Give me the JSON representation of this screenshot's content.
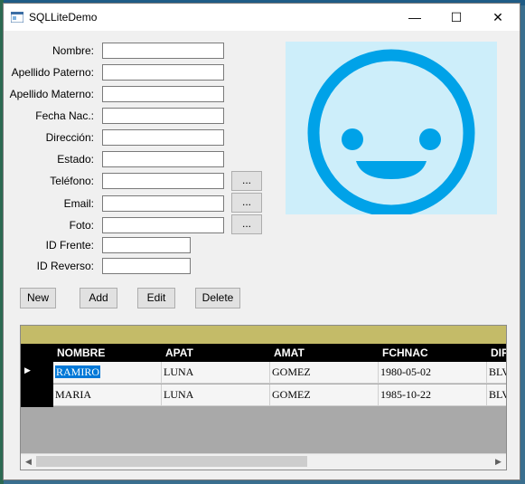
{
  "window": {
    "title": "SQLLiteDemo",
    "minimize": "—",
    "maximize": "☐",
    "close": "✕"
  },
  "form": {
    "labels": {
      "nombre": "Nombre:",
      "apellido_paterno": "Apellido Paterno:",
      "apellido_materno": "Apellido Materno:",
      "fecha_nac": "Fecha Nac.:",
      "direccion": "Dirección:",
      "estado": "Estado:",
      "telefono": "Teléfono:",
      "email": "Email:",
      "foto": "Foto:",
      "id_frente": "ID Frente:",
      "id_reverso": "ID Reverso:"
    },
    "values": {
      "nombre": "",
      "apellido_paterno": "",
      "apellido_materno": "",
      "fecha_nac": "",
      "direccion": "",
      "estado": "",
      "telefono": "",
      "email": "",
      "foto": "",
      "id_frente": "",
      "id_reverso": ""
    },
    "browse_label": "..."
  },
  "photo": {
    "icon": "smiley-face-icon",
    "bg": "#cdeefa",
    "fg": "#00a2e8"
  },
  "buttons": {
    "new": "New",
    "add": "Add",
    "edit": "Edit",
    "delete": "Delete"
  },
  "grid": {
    "columns": [
      "NOMBRE",
      "APAT",
      "AMAT",
      "FCHNAC",
      "DIR"
    ],
    "rows": [
      [
        "RAMIRO",
        "LUNA",
        "GOMEZ",
        "1980-05-02",
        "BLV"
      ],
      [
        "MARIA",
        "LUNA",
        "GOMEZ",
        "1985-10-22",
        "BLV"
      ]
    ],
    "current_row_marker": "▶",
    "selected_cell": "RAMIRO",
    "header_color": "#000000",
    "caption_color": "#c4bb68",
    "scroll_left": "◀",
    "scroll_right": "▶"
  }
}
